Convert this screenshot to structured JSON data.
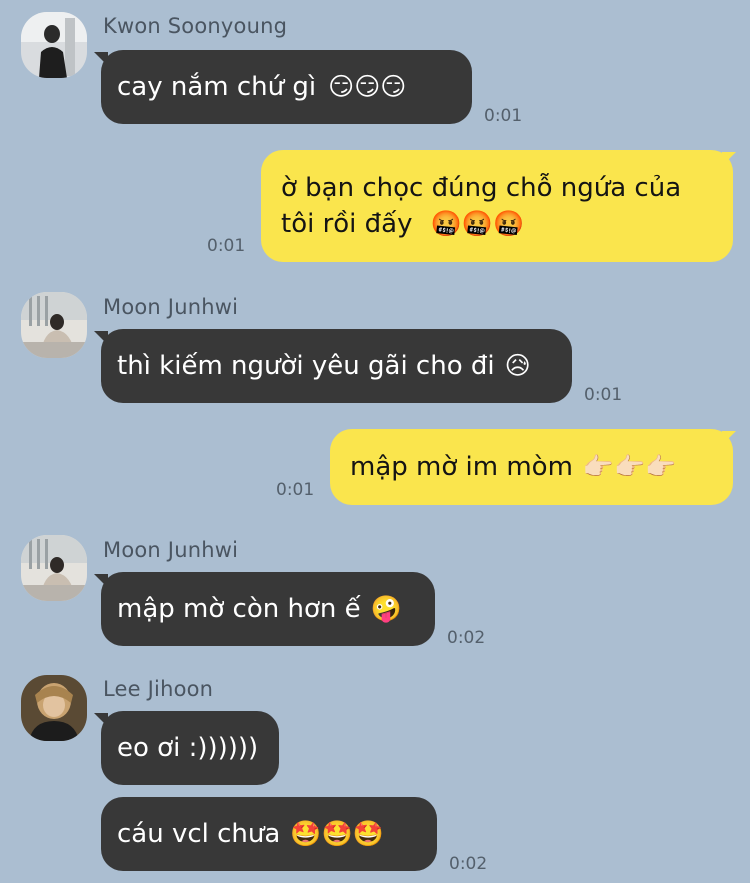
{
  "chat": {
    "messages": [
      {
        "sender": "Kwon Soonyoung",
        "text": "cay nắm chứ gì",
        "emoji": "😏😏😏",
        "time": "0:01",
        "direction": "incoming"
      },
      {
        "sender": "",
        "text_line1": "ờ bạn chọc đúng chỗ ngứa của",
        "text_line2": "tôi rồi đấy",
        "emoji": "🤬🤬🤬",
        "time": "0:01",
        "direction": "outgoing"
      },
      {
        "sender": "Moon Junhwi",
        "text": "thì kiếm người yêu gãi cho đi",
        "emoji": "😥",
        "time": "0:01",
        "direction": "incoming"
      },
      {
        "sender": "",
        "text": "mập mờ im mòm",
        "emoji": "👉🏻👉🏻👉🏻",
        "time": "0:01",
        "direction": "outgoing"
      },
      {
        "sender": "Moon Junhwi",
        "text": "mập mờ còn hơn ế",
        "emoji": "🤪",
        "time": "0:02",
        "direction": "incoming"
      },
      {
        "sender": "Lee Jihoon",
        "text": "eo ơi :))))))",
        "time": "",
        "direction": "incoming"
      },
      {
        "sender": "",
        "text": "cáu vcl chưa",
        "emoji": "🤩🤩🤩",
        "time": "0:02",
        "direction": "incoming"
      }
    ]
  },
  "colors": {
    "background": "#abbed1",
    "incoming_bubble": "#383838",
    "outgoing_bubble": "#fae54d"
  }
}
